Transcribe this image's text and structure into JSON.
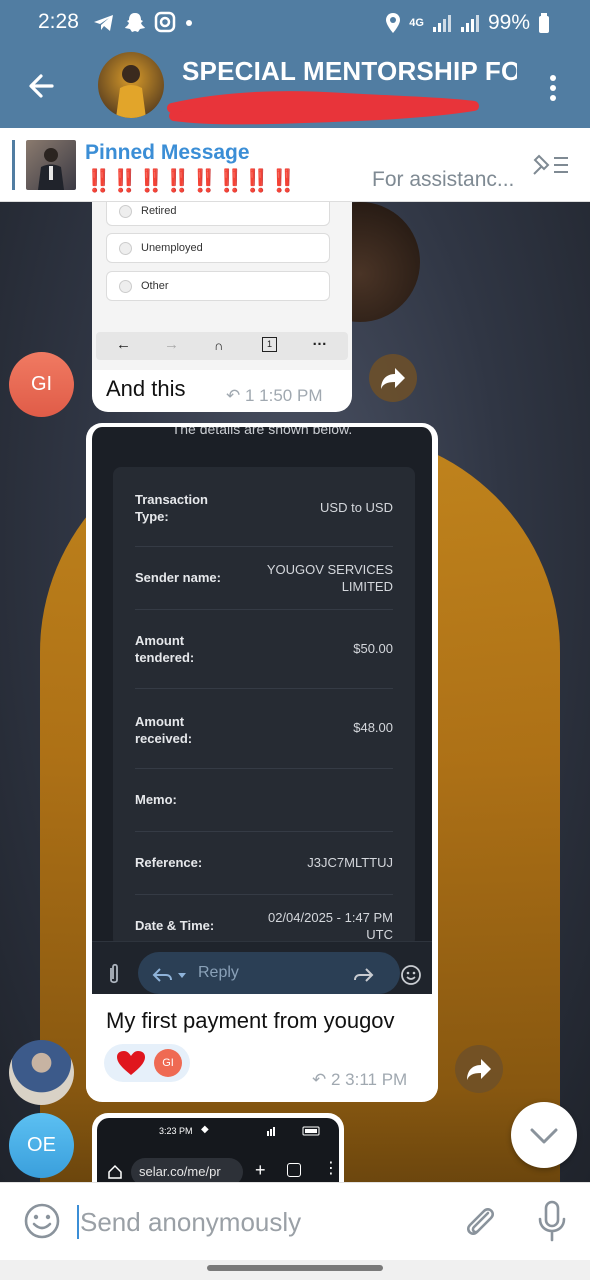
{
  "status": {
    "time": "2:28",
    "network": "4G",
    "battery": "99%"
  },
  "header": {
    "title": "SPECIAL MENTORSHIP FO",
    "subtitle": ""
  },
  "pinned": {
    "title": "Pinned Message",
    "marks": "‼️‼️‼️‼️‼️‼️‼️‼️",
    "preview": "For assistanc..."
  },
  "messages": [
    {
      "sender_initials": "GI",
      "form_options": [
        "Retired",
        "Unemployed",
        "Other"
      ],
      "text": "And this",
      "replies": "1",
      "time": "1:50 PM"
    },
    {
      "receipt": {
        "heading": "The details are shown below.",
        "rows": [
          {
            "label": "Transaction Type:",
            "value": "USD to USD"
          },
          {
            "label": "Sender name:",
            "value": "YOUGOV SERVICES LIMITED"
          },
          {
            "label": "Amount tendered:",
            "value": "$50.00"
          },
          {
            "label": "Amount received:",
            "value": "$48.00"
          },
          {
            "label": "Memo:",
            "value": ""
          },
          {
            "label": "Reference:",
            "value": "J3JC7MLTTUJ"
          },
          {
            "label": "Date & Time:",
            "value": "02/04/2025 - 1:47 PM UTC"
          }
        ],
        "reply_placeholder": "Reply"
      },
      "text": "My first payment from yougov",
      "reaction_initials": "GI",
      "replies": "2",
      "time": "3:11 PM"
    },
    {
      "sender_initials": "OE",
      "phone_time": "3:23 PM",
      "url": "selar.co/me/pr"
    }
  ],
  "input": {
    "placeholder": "Send anonymously"
  },
  "colors": {
    "header": "#517da2",
    "accent": "#3b8ed6",
    "reply_avatar_gi": "#ef6a53",
    "avatar_oe": "#4aafe8"
  }
}
